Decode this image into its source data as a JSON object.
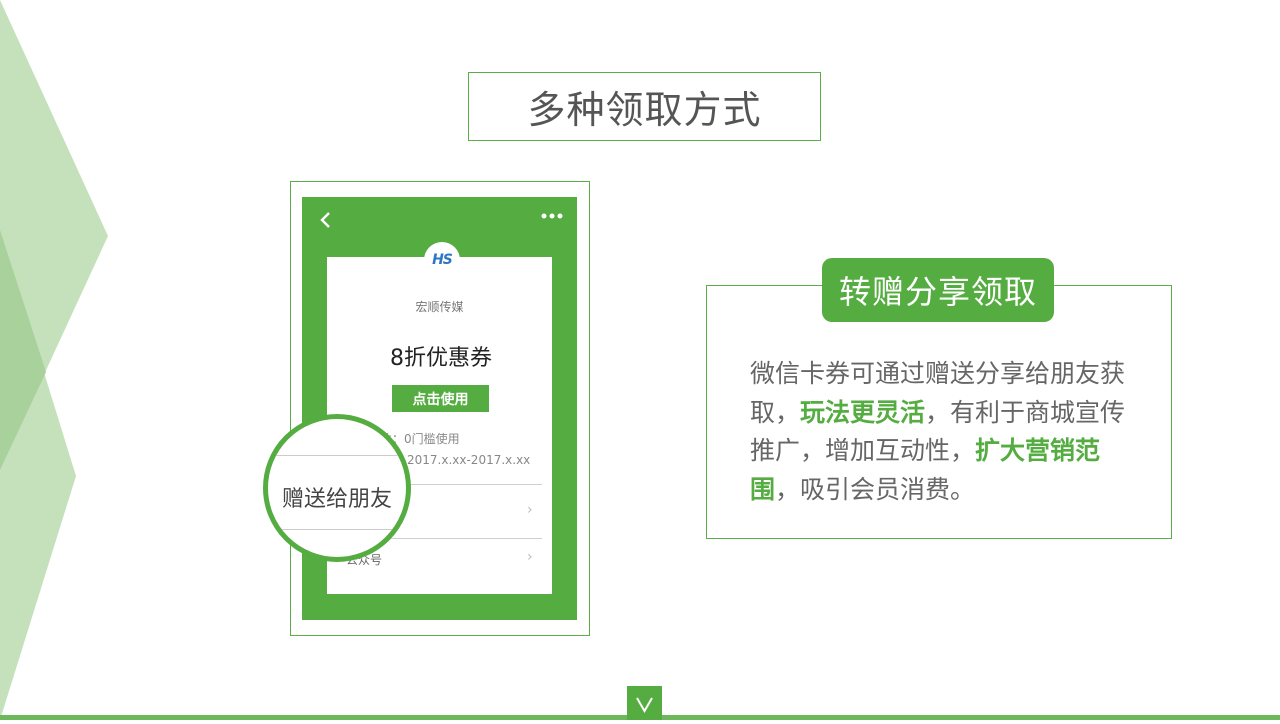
{
  "slide": {
    "title": "多种领取方式",
    "badge": "转赠分享领取",
    "description": {
      "t1": "微信卡券可通过赠送分享给朋友获取，",
      "h1": "玩法更灵活",
      "t2": "，有利于商城宣传推广，增加互动性，",
      "h2": "扩大营销范围",
      "t3": "，吸引会员消费。"
    }
  },
  "phone": {
    "logo": "HS",
    "brand": "宏顺传媒",
    "coupon_title": "8折优惠券",
    "use_button": "点击使用",
    "condition": "件：0门槛使用",
    "date_range": "2017.x.xx-2017.x.xx",
    "list_item_public": "公众号",
    "magnified_text": "赠送给朋友"
  },
  "colors": {
    "accent": "#55ac41",
    "frame": "#5aae47",
    "text": "#666666",
    "deco_light": "#c5e1bc"
  },
  "icons": [
    "back-arrow-icon",
    "more-dots-icon",
    "chevron-right-icon",
    "chevron-down-icon"
  ]
}
